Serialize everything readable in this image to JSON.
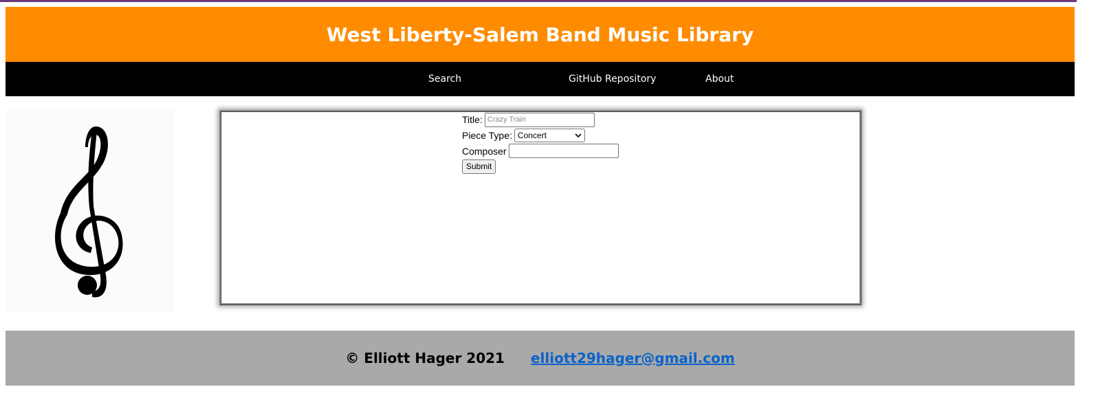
{
  "header": {
    "title": "West Liberty-Salem Band Music Library"
  },
  "nav": {
    "items": [
      {
        "label": "Search"
      },
      {
        "label": "GitHub Repository"
      },
      {
        "label": "About"
      }
    ]
  },
  "form": {
    "title_label": "Title:",
    "title_placeholder": "Crazy Train",
    "title_value": "",
    "piece_type_label": "Piece Type:",
    "piece_type_value": "Concert",
    "composer_label": "Composer",
    "composer_value": "",
    "submit_label": "Submit"
  },
  "icons": {
    "logo": "treble-clef-icon",
    "dropdown": "chevron-down-icon"
  },
  "footer": {
    "copyright": "© Elliott Hager 2021",
    "email": "elliott29hager@gmail.com"
  },
  "colors": {
    "header_bg": "#ff8c00",
    "nav_bg": "#000000",
    "footer_bg": "#a9a9a9",
    "link": "#0b63c9"
  }
}
